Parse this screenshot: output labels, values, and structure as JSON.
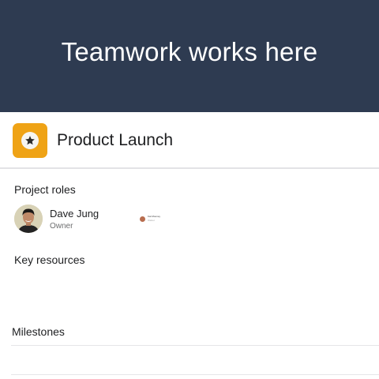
{
  "hero": {
    "title": "Teamwork works here"
  },
  "project": {
    "name": "Product Launch",
    "icon": "star-icon",
    "icon_color": "#efa316"
  },
  "sections": {
    "roles_label": "Project roles",
    "resources_label": "Key resources",
    "milestones_label": "Milestones"
  },
  "members": [
    {
      "name": "Dave Jung",
      "role": "Owner"
    }
  ],
  "mini_member": {
    "name": "Kat Mooney",
    "role": "Owner"
  },
  "colors": {
    "hero_background": "#2e3b51",
    "accent": "#efa316"
  }
}
